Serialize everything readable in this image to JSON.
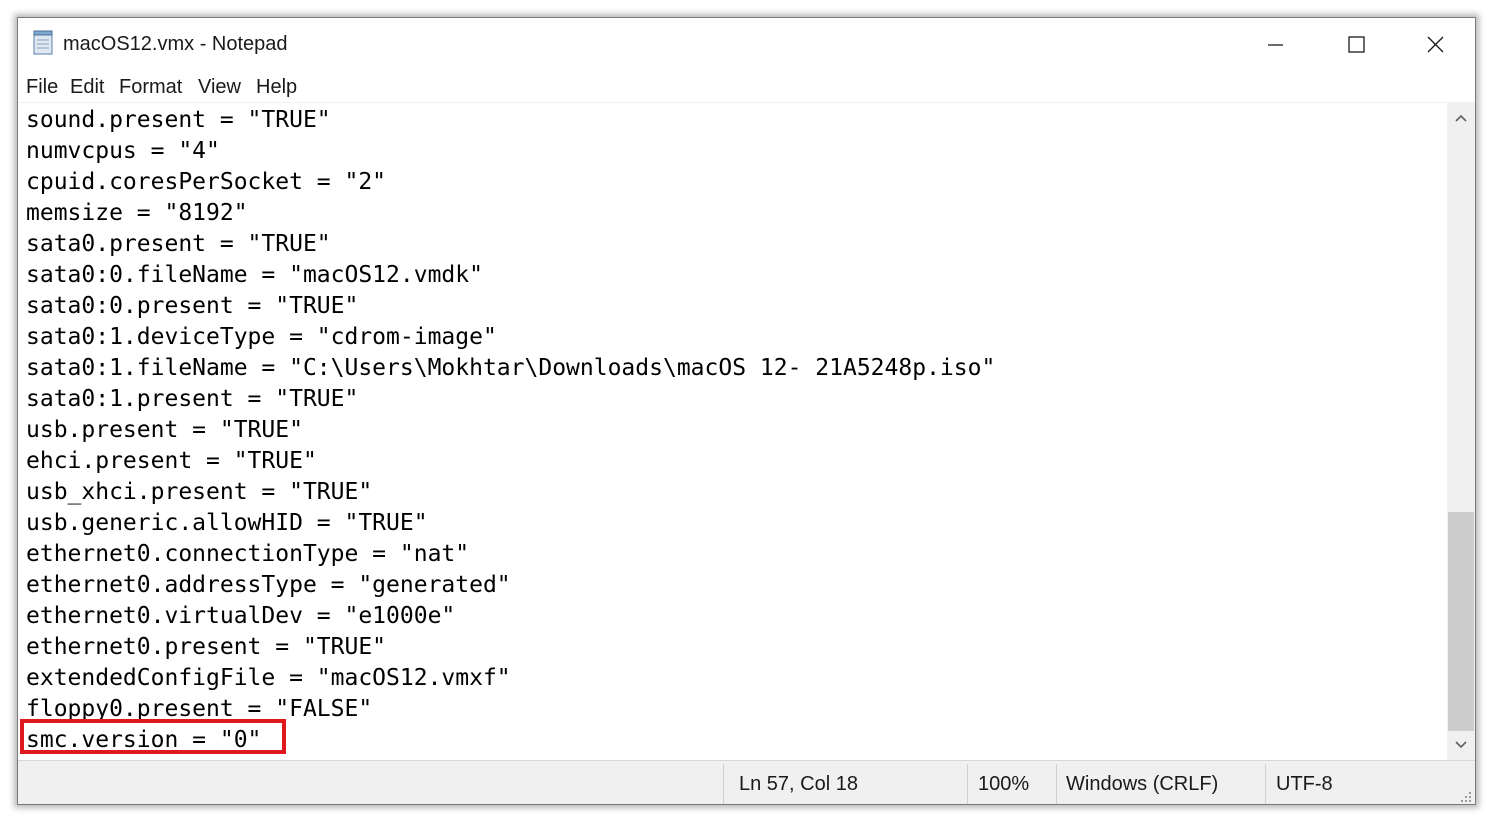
{
  "window": {
    "title": "macOS12.vmx - Notepad",
    "app_icon": "notepad-icon",
    "controls": {
      "minimize_icon": "minimize-icon",
      "maximize_icon": "maximize-icon",
      "close_icon": "close-icon"
    }
  },
  "menu": {
    "items": [
      "File",
      "Edit",
      "Format",
      "View",
      "Help"
    ]
  },
  "editor": {
    "lines": [
      "sound.present = \"TRUE\"",
      "numvcpus = \"4\"",
      "cpuid.coresPerSocket = \"2\"",
      "memsize = \"8192\"",
      "sata0.present = \"TRUE\"",
      "sata0:0.fileName = \"macOS12.vmdk\"",
      "sata0:0.present = \"TRUE\"",
      "sata0:1.deviceType = \"cdrom-image\"",
      "sata0:1.fileName = \"C:\\Users\\Mokhtar\\Downloads\\macOS 12- 21A5248p.iso\"",
      "sata0:1.present = \"TRUE\"",
      "usb.present = \"TRUE\"",
      "ehci.present = \"TRUE\"",
      "usb_xhci.present = \"TRUE\"",
      "usb.generic.allowHID = \"TRUE\"",
      "ethernet0.connectionType = \"nat\"",
      "ethernet0.addressType = \"generated\"",
      "ethernet0.virtualDev = \"e1000e\"",
      "ethernet0.present = \"TRUE\"",
      "extendedConfigFile = \"macOS12.vmxf\"",
      "floppy0.present = \"FALSE\"",
      "smc.version = \"0\""
    ],
    "highlight_color": "#e0191f"
  },
  "scrollbar": {
    "up_icon": "chevron-up-icon",
    "down_icon": "chevron-down-icon"
  },
  "status": {
    "position": "Ln 57, Col 18",
    "zoom": "100%",
    "line_ending": "Windows (CRLF)",
    "encoding": "UTF-8"
  }
}
